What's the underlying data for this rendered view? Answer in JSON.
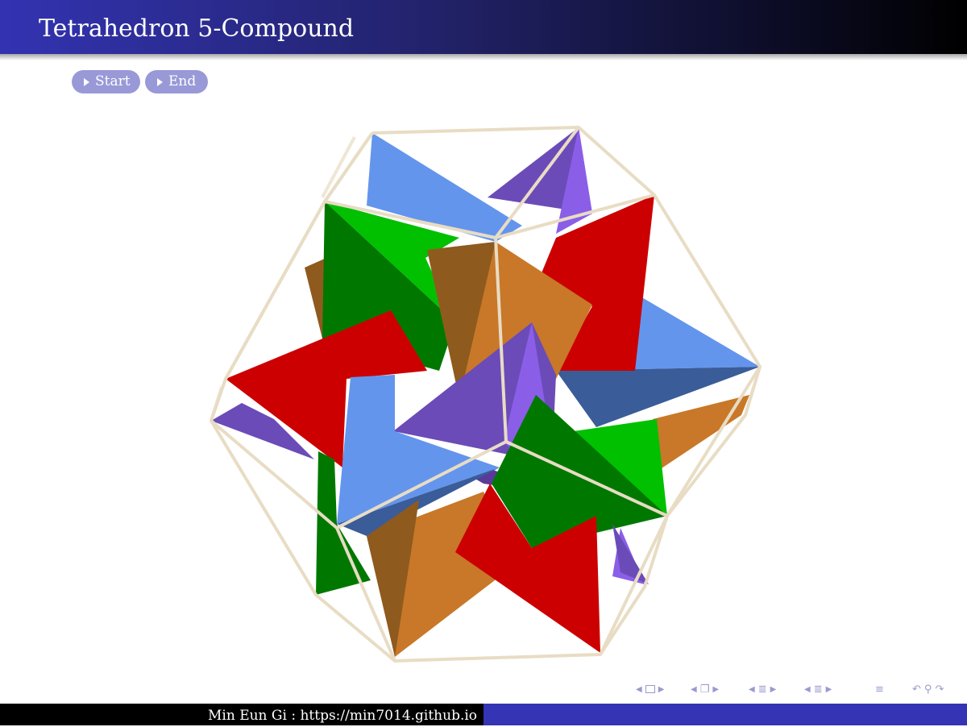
{
  "header": {
    "title": "Tetrahedron 5-Compound"
  },
  "buttons": {
    "start_label": "Start",
    "end_label": "End",
    "accent": "#9999d8"
  },
  "footer": {
    "author_text": "Min Eun Gi : https://min7014.github.io"
  },
  "nav": {
    "icons": [
      "nav-prev-icon",
      "frame-icon",
      "nav-next-icon",
      "section-icon",
      "subsection-icon",
      "subsubsection-icon",
      "toc-icon",
      "undo-icon",
      "search-icon",
      "redo-icon"
    ]
  },
  "colors": {
    "header_gradient_start": "#3333b2",
    "header_gradient_end": "#000000",
    "footer_right": "#3434b5",
    "edges": "#e8dcc4",
    "blue": "#6495ed",
    "purple": "#6b4bb8",
    "red": "#cc0000",
    "green": "#00c000",
    "orange": "#c87828"
  }
}
